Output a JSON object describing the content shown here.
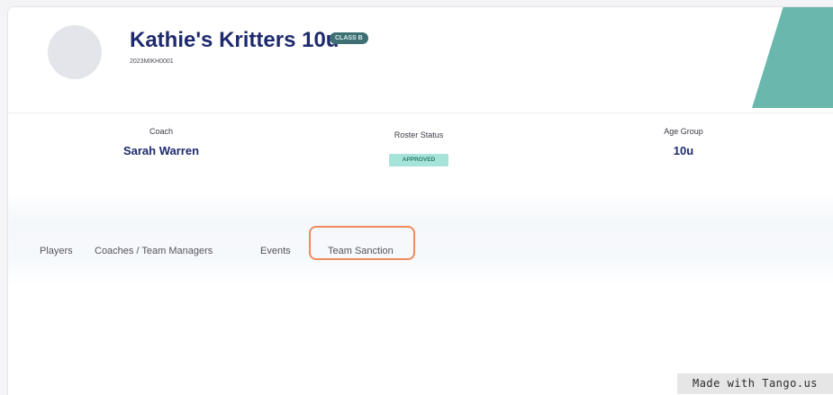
{
  "team": {
    "name": "Kathie's Kritters 10u",
    "class_badge": "CLASS B",
    "id": "2023MIKH0001"
  },
  "info": {
    "coach_label": "Coach",
    "coach_value": "Sarah Warren",
    "roster_label": "Roster Status",
    "roster_value": "APPROVED",
    "age_label": "Age Group",
    "age_value": "10u"
  },
  "tabs": [
    {
      "label": "Players"
    },
    {
      "label": "Coaches / Team Managers"
    },
    {
      "label": "Events"
    },
    {
      "label": "Team Sanction"
    }
  ],
  "watermark": "Made with Tango.us",
  "colors": {
    "brand_navy": "#1e2a6d",
    "accent_teal": "#6ab7ad",
    "status_green": "#a6e3d8",
    "highlight_orange": "#f08a5d"
  }
}
